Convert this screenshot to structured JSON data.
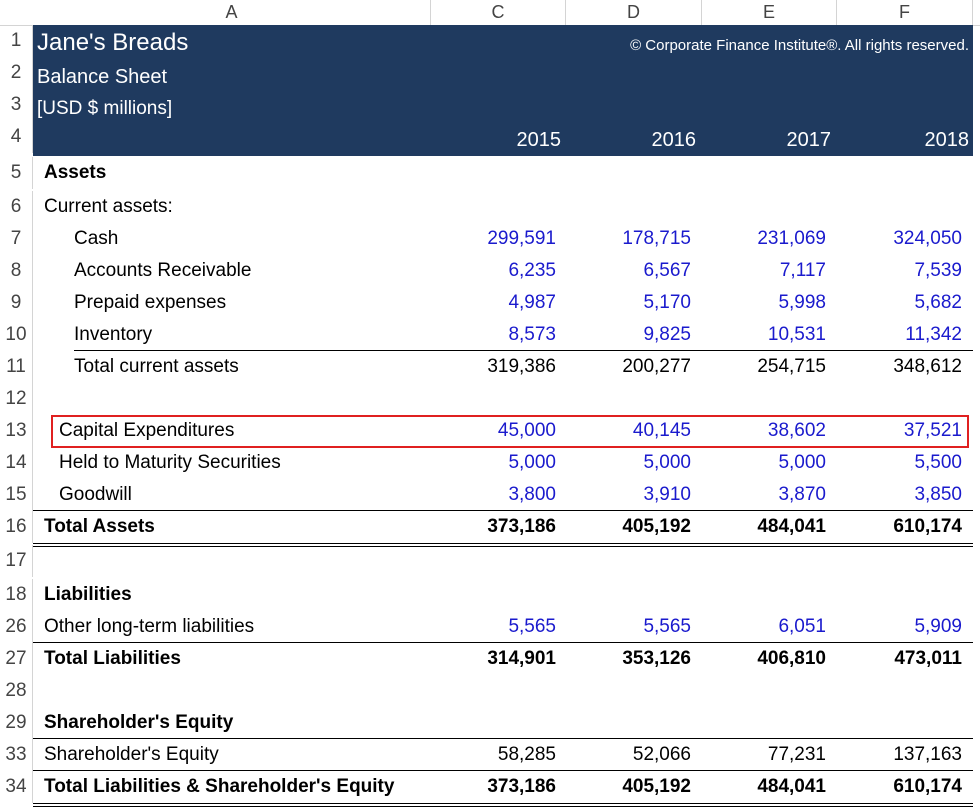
{
  "columns": [
    "A",
    "C",
    "D",
    "E",
    "F"
  ],
  "banner": {
    "title": "Jane's Breads",
    "subtitle": "Balance Sheet",
    "units": "[USD $ millions]",
    "copyright": "© Corporate Finance Institute®. All rights reserved.",
    "years": [
      "2015",
      "2016",
      "2017",
      "2018"
    ]
  },
  "row_numbers": [
    "1",
    "2",
    "3",
    "4",
    "5",
    "6",
    "7",
    "8",
    "9",
    "10",
    "11",
    "12",
    "13",
    "14",
    "15",
    "16",
    "17",
    "18",
    "26",
    "27",
    "28",
    "29",
    "33",
    "34"
  ],
  "rows": [
    {
      "label": "Assets",
      "values": []
    },
    {
      "label": "Current assets:",
      "values": []
    },
    {
      "label": "Cash",
      "values": [
        "299,591",
        "178,715",
        "231,069",
        "324,050"
      ]
    },
    {
      "label": "Accounts Receivable",
      "values": [
        "6,235",
        "6,567",
        "7,117",
        "7,539"
      ]
    },
    {
      "label": "Prepaid expenses",
      "values": [
        "4,987",
        "5,170",
        "5,998",
        "5,682"
      ]
    },
    {
      "label": "Inventory",
      "values": [
        "8,573",
        "9,825",
        "10,531",
        "11,342"
      ]
    },
    {
      "label": "Total current assets",
      "values": [
        "319,386",
        "200,277",
        "254,715",
        "348,612"
      ]
    },
    {
      "label": "",
      "values": []
    },
    {
      "label": "Capital Expenditures",
      "values": [
        "45,000",
        "40,145",
        "38,602",
        "37,521"
      ]
    },
    {
      "label": "Held to Maturity Securities",
      "values": [
        "5,000",
        "5,000",
        "5,000",
        "5,500"
      ]
    },
    {
      "label": "Goodwill",
      "values": [
        "3,800",
        "3,910",
        "3,870",
        "3,850"
      ]
    },
    {
      "label": "Total Assets",
      "values": [
        "373,186",
        "405,192",
        "484,041",
        "610,174"
      ]
    },
    {
      "label": "",
      "values": []
    },
    {
      "label": "Liabilities",
      "values": []
    },
    {
      "label": "Other long-term liabilities",
      "values": [
        "5,565",
        "5,565",
        "6,051",
        "5,909"
      ]
    },
    {
      "label": "Total Liabilities",
      "values": [
        "314,901",
        "353,126",
        "406,810",
        "473,011"
      ]
    },
    {
      "label": "",
      "values": []
    },
    {
      "label": "Shareholder's Equity",
      "values": []
    },
    {
      "label": "Shareholder's Equity",
      "values": [
        "58,285",
        "52,066",
        "77,231",
        "137,163"
      ]
    },
    {
      "label": "Total Liabilities & Shareholder's Equity",
      "values": [
        "373,186",
        "405,192",
        "484,041",
        "610,174"
      ]
    }
  ],
  "colors": {
    "banner": "#1f3a5f",
    "input_blue": "#1a1acd",
    "highlight": "#e02020"
  }
}
